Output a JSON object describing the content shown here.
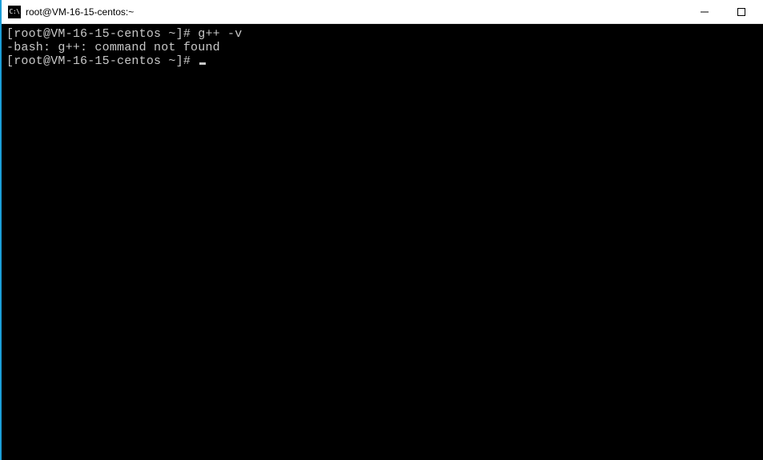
{
  "titlebar": {
    "icon_label": "C:\\",
    "title": "root@VM-16-15-centos:~"
  },
  "terminal": {
    "lines": [
      {
        "prompt": "[root@VM-16-15-centos ~]# ",
        "command": "g++ -v",
        "has_cursor": false
      },
      {
        "text": "-bash: g++: command not found",
        "has_cursor": false
      },
      {
        "prompt": "[root@VM-16-15-centos ~]# ",
        "command": "",
        "has_cursor": true
      }
    ]
  }
}
